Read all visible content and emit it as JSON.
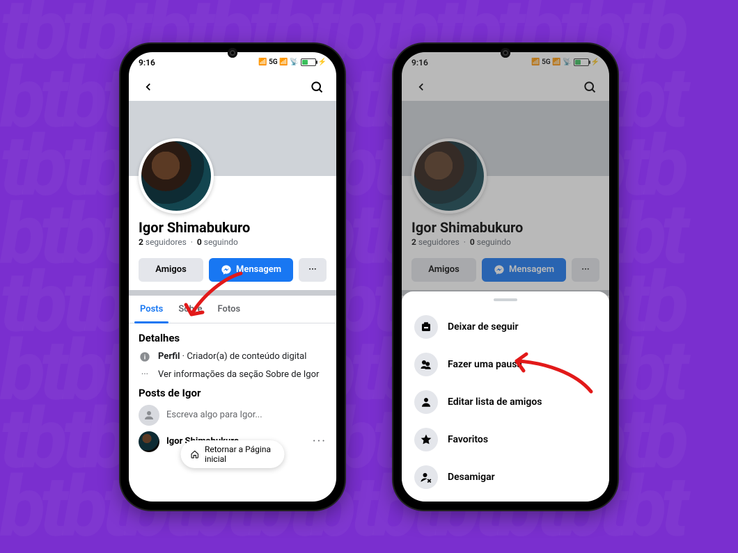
{
  "statusbar": {
    "time": "9:16",
    "net": "5G"
  },
  "profile": {
    "name": "Igor Shimabukuro",
    "followers_count": "2",
    "followers_label": "seguidores",
    "sep": "·",
    "following_count": "0",
    "following_label": "seguindo"
  },
  "actions": {
    "friends": "Amigos",
    "message": "Mensagem",
    "more": "···"
  },
  "tabs": {
    "posts": "Posts",
    "about": "Sobre",
    "photos": "Fotos"
  },
  "details": {
    "heading": "Detalhes",
    "profile_label": "Perfil",
    "profile_desc": "Criador(a) de conteúdo digital",
    "see_about": "Ver informações da seção Sobre de Igor"
  },
  "posts": {
    "heading": "Posts de Igor",
    "compose_placeholder": "Escreva algo para Igor...",
    "author": "Igor Shimabukuro"
  },
  "toast": {
    "text": "Retornar a Página inicial"
  },
  "sheet": {
    "unfollow": "Deixar de seguir",
    "snooze": "Fazer uma pausa",
    "edit_list": "Editar lista de amigos",
    "favorites": "Favoritos",
    "unfriend": "Desamigar"
  }
}
